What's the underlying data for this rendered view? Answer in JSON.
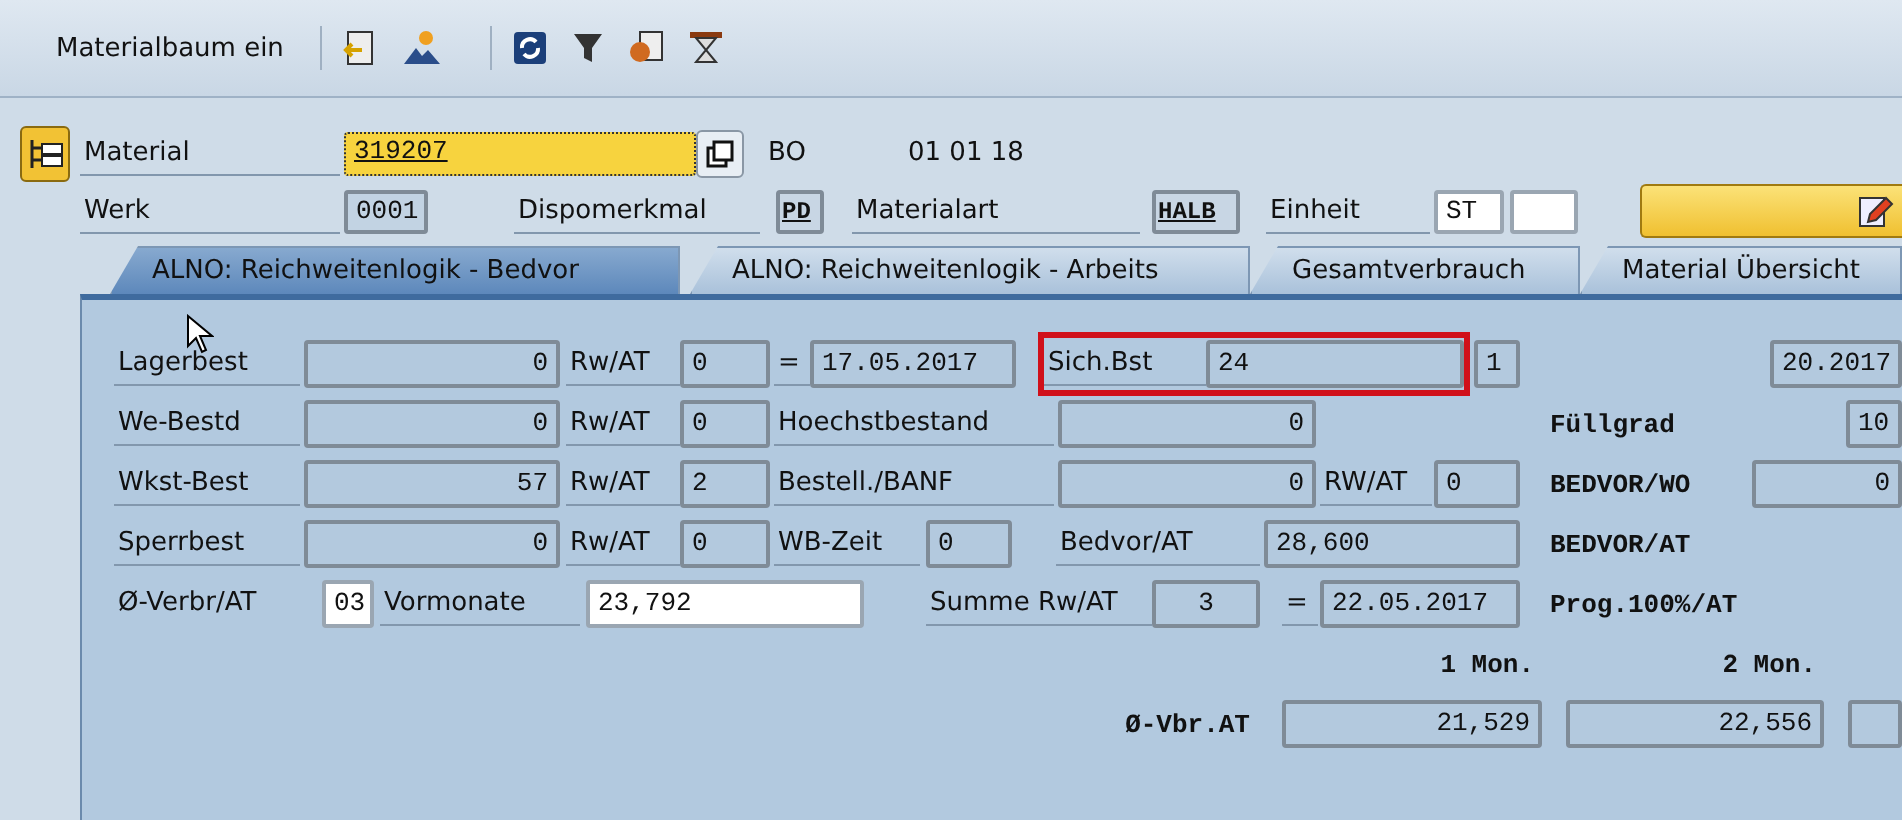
{
  "toolbar": {
    "button": "Materialbaum ein"
  },
  "header": {
    "lines": [
      {
        "items": [
          {
            "kind": "icon_button"
          },
          {
            "kind": "label",
            "text": "Material"
          },
          {
            "kind": "field",
            "value": "319207"
          },
          {
            "kind": "icon_button"
          },
          {
            "kind": "text",
            "text": "BO"
          },
          {
            "kind": "text",
            "text": "01 01 18"
          }
        ]
      },
      {
        "items": [
          {
            "kind": "label",
            "text": "Werk"
          },
          {
            "kind": "field",
            "value": "0001"
          },
          {
            "kind": "label",
            "text": "Dispomerkmal"
          },
          {
            "kind": "field",
            "value": "PD"
          },
          {
            "kind": "label",
            "text": "Materialart"
          },
          {
            "kind": "field",
            "value": "HALB"
          },
          {
            "kind": "label",
            "text": "Einheit"
          },
          {
            "kind": "field",
            "value": "ST"
          },
          {
            "kind": "field"
          },
          {
            "kind": "icon_button"
          }
        ]
      }
    ]
  },
  "tabs": [
    {
      "label": "ALNO: Reichweitenlogik - Bedvor",
      "selected": true
    },
    {
      "label": "ALNO: Reichweitenlogik - Arbeits",
      "selected": false
    },
    {
      "label": "Gesamtverbrauch",
      "selected": false
    },
    {
      "label": "Material Übersicht",
      "selected": false
    }
  ],
  "panel": {
    "lines": [
      {
        "items": [
          {
            "kind": "label",
            "text": "Lagerbest"
          },
          {
            "kind": "field",
            "value": "0"
          },
          {
            "kind": "label",
            "text": "Rw/AT"
          },
          {
            "kind": "field",
            "value": "0"
          },
          {
            "kind": "label",
            "text": "="
          },
          {
            "kind": "field",
            "value": "17.05.2017"
          },
          {
            "kind": "frame",
            "items": [
              {
                "kind": "label",
                "text": "Sich.Bst"
              },
              {
                "kind": "field",
                "value": "24"
              }
            ]
          },
          {
            "kind": "field",
            "value": "1"
          },
          {
            "kind": "field",
            "value": "20.2017"
          }
        ]
      },
      {
        "items": [
          {
            "kind": "label",
            "text": "We-Bestd"
          },
          {
            "kind": "field",
            "value": "0"
          },
          {
            "kind": "label",
            "text": "Rw/AT"
          },
          {
            "kind": "field",
            "value": "0"
          },
          {
            "kind": "label",
            "text": "Hoechstbestand"
          },
          {
            "kind": "field",
            "value": "0"
          },
          {
            "kind": "mono",
            "text": "Füllgrad"
          },
          {
            "kind": "field",
            "value": "10"
          }
        ]
      },
      {
        "items": [
          {
            "kind": "label",
            "text": "Wkst-Best"
          },
          {
            "kind": "field",
            "value": "57"
          },
          {
            "kind": "label",
            "text": "Rw/AT"
          },
          {
            "kind": "field",
            "value": "2"
          },
          {
            "kind": "label",
            "text": "Bestell./BANF"
          },
          {
            "kind": "field",
            "value": "0"
          },
          {
            "kind": "label",
            "text": "RW/AT"
          },
          {
            "kind": "field",
            "value": "0"
          },
          {
            "kind": "mono",
            "text": "BEDVOR/WO"
          },
          {
            "kind": "field",
            "value": "0"
          }
        ]
      },
      {
        "items": [
          {
            "kind": "label",
            "text": "Sperrbest"
          },
          {
            "kind": "field",
            "value": "0"
          },
          {
            "kind": "label",
            "text": "Rw/AT"
          },
          {
            "kind": "field",
            "value": "0"
          },
          {
            "kind": "label",
            "text": "WB-Zeit"
          },
          {
            "kind": "field",
            "value": "0"
          },
          {
            "kind": "label",
            "text": "Bedvor/AT"
          },
          {
            "kind": "field",
            "value": "28,600"
          },
          {
            "kind": "mono",
            "text": "BEDVOR/AT"
          }
        ]
      },
      {
        "items": [
          {
            "kind": "text",
            "text": "Ø-Verbr/AT"
          },
          {
            "kind": "field",
            "value": "03"
          },
          {
            "kind": "label",
            "text": "Vormonate"
          },
          {
            "kind": "field",
            "value": "23,792"
          },
          {
            "kind": "label",
            "text": "Summe Rw/AT"
          },
          {
            "kind": "field",
            "value": "3"
          },
          {
            "kind": "label",
            "text": "="
          },
          {
            "kind": "field",
            "value": "22.05.2017"
          },
          {
            "kind": "mono",
            "text": "Prog.100%/AT"
          }
        ]
      },
      {
        "items": [
          {
            "kind": "mono",
            "text": "1 Mon."
          },
          {
            "kind": "mono",
            "text": "2 Mon."
          }
        ]
      },
      {
        "items": [
          {
            "kind": "mono",
            "text": "Ø-Vbr.AT"
          },
          {
            "kind": "field",
            "value": "21,529"
          },
          {
            "kind": "field",
            "value": "22,556"
          },
          {
            "kind": "field"
          }
        ]
      }
    ]
  }
}
